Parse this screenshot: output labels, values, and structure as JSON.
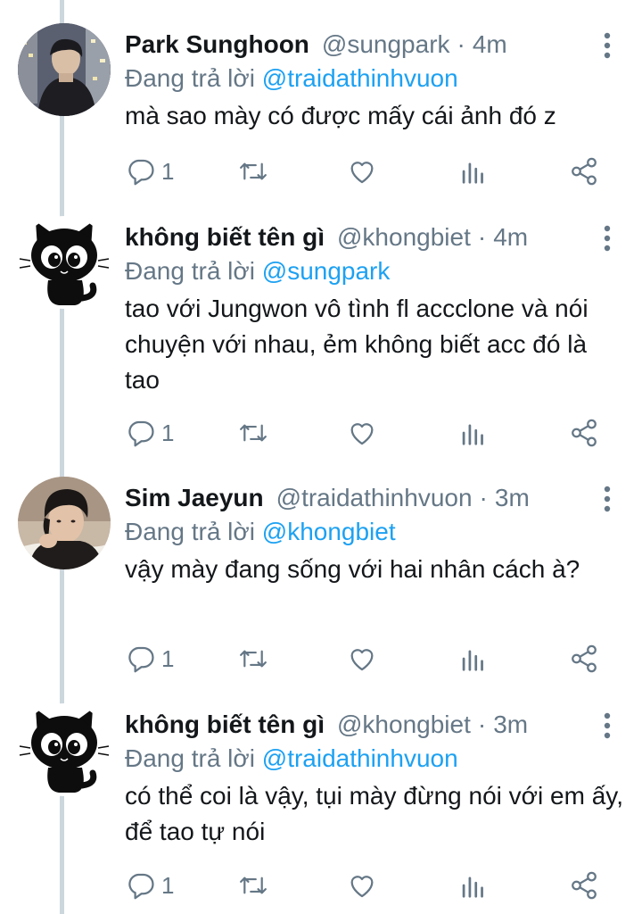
{
  "replying_prefix": "Đang trả lời",
  "tweets": [
    {
      "name": "Park Sunghoon",
      "handle": "@sungpark",
      "sep": "·",
      "time": "4m",
      "reply_to": "@traidathinhvuon",
      "text": "mà sao mày có được mấy cái ảnh đó z",
      "reply_count": "1",
      "avatar": "photo-avatar-night-city"
    },
    {
      "name": "không biết tên gì",
      "handle": "@khongbiet",
      "sep": "·",
      "time": "4m",
      "reply_to": "@sungpark",
      "text": "tao với Jungwon vô tình fl accclone và nói chuyện với nhau, ẻm không biết acc đó là tao",
      "reply_count": "1",
      "avatar": "black-cat-avatar"
    },
    {
      "name": "Sim Jaeyun",
      "handle": "@traidathinhvuon",
      "sep": "·",
      "time": "3m",
      "reply_to": "@khongbiet",
      "text": "vậy mày đang sống với hai nhân cách à?",
      "reply_count": "1",
      "avatar": "photo-avatar-portrait"
    },
    {
      "name": "không biết tên gì",
      "handle": "@khongbiet",
      "sep": "·",
      "time": "3m",
      "reply_to": "@traidathinhvuon",
      "text": "có thể coi là vậy, tụi mày đừng nói với em ấy, để tao tự nói",
      "reply_count": "1",
      "avatar": "black-cat-avatar"
    }
  ],
  "colors": {
    "text": "#14171a",
    "secondary": "#657786",
    "link": "#1da1f2",
    "thread_line": "#ccd6dd"
  },
  "icons": [
    "reply-icon",
    "retweet-icon",
    "like-icon",
    "analytics-icon",
    "share-icon",
    "more-icon"
  ]
}
